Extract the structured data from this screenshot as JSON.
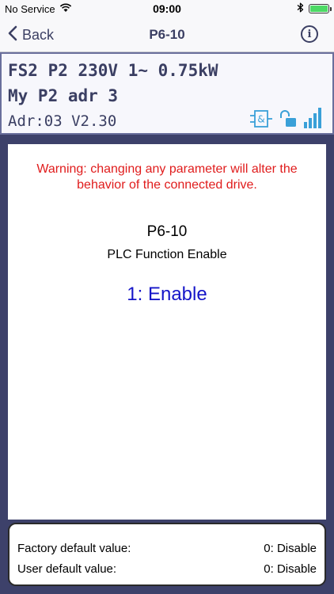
{
  "status_bar": {
    "carrier": "No Service",
    "time": "09:00",
    "wifi_icon": "wifi-icon",
    "bluetooth_icon": "bluetooth-icon",
    "battery_icon": "battery-icon",
    "battery_level": 1.0
  },
  "nav": {
    "back_label": "Back",
    "title": "P6-10",
    "info_label": "i"
  },
  "device": {
    "line1": "FS2 P2 230V 1~ 0.75kW",
    "line2": "My P2 adr 3",
    "line3": "Adr:03 V2.30",
    "icons": [
      "logic-block-icon",
      "unlocked-icon",
      "signal-strength-icon"
    ]
  },
  "parameter": {
    "warning": "Warning: changing any parameter will alter the behavior of the connected drive.",
    "code": "P6-10",
    "name": "PLC Function Enable",
    "value": "1: Enable"
  },
  "defaults": {
    "factory_label": "Factory default value:",
    "factory_value": "0: Disable",
    "user_label": "User default value:",
    "user_value": "0: Disable"
  },
  "colors": {
    "accent": "#3b3f63",
    "warning": "#e01c1c",
    "value": "#1515c8",
    "frame": "#3d416a",
    "icon_blue": "#3aa0d8"
  }
}
